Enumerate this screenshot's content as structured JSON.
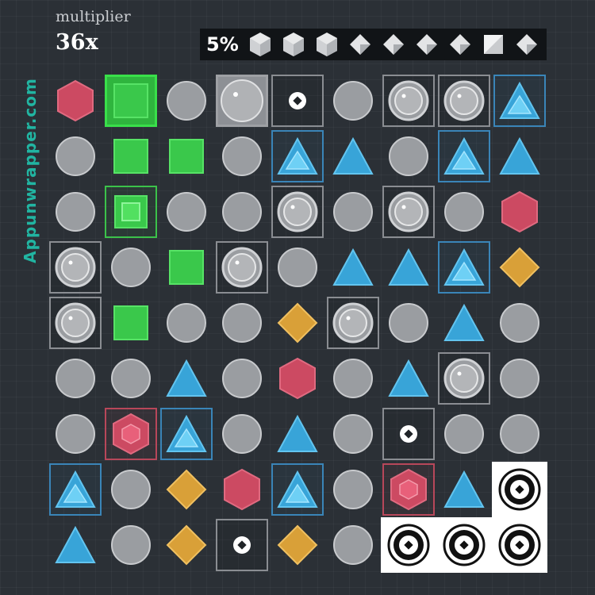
{
  "header": {
    "multiplier_label": "multiplier",
    "multiplier_value": "36x"
  },
  "progress": {
    "percent_text": "5%",
    "icons": [
      "cube-icon",
      "cube-icon",
      "cube-icon",
      "diamond-icon",
      "diamond-icon",
      "diamond-icon",
      "diamond-icon",
      "square-icon",
      "diamond-icon"
    ]
  },
  "watermark": "Appunwrapper.com",
  "colors": {
    "background": "#2b3036",
    "gray_piece": "#9a9da1",
    "green_piece": "#3ac84b",
    "blue_piece": "#38a4d8",
    "red_piece": "#cc4a62",
    "orange_piece": "#d9a038",
    "watermark": "#21b5a2"
  },
  "board": {
    "rows": 9,
    "cols": 9,
    "cells": [
      [
        {
          "p": "hexagon-red"
        },
        {
          "p": "square-green",
          "f": "greenfill"
        },
        {
          "p": "circle-gray"
        },
        {
          "p": "circle-bubble-big",
          "f": "grayfill"
        },
        {
          "p": "dot-target",
          "f": "gray"
        },
        {
          "p": "circle-gray"
        },
        {
          "p": "circle-bubble",
          "f": "gray"
        },
        {
          "p": "circle-bubble",
          "f": "gray"
        },
        {
          "p": "triangle-blue-inner",
          "f": "blue"
        }
      ],
      [
        {
          "p": "circle-gray"
        },
        {
          "p": "square-green"
        },
        {
          "p": "square-green"
        },
        {
          "p": "circle-gray"
        },
        {
          "p": "triangle-blue-inner",
          "f": "blue"
        },
        {
          "p": "triangle-blue"
        },
        {
          "p": "circle-gray"
        },
        {
          "p": "triangle-blue-inner",
          "f": "blue"
        },
        {
          "p": "triangle-blue"
        }
      ],
      [
        {
          "p": "circle-gray"
        },
        {
          "p": "square-green-inner",
          "f": "green"
        },
        {
          "p": "circle-gray"
        },
        {
          "p": "circle-gray"
        },
        {
          "p": "circle-bubble",
          "f": "gray"
        },
        {
          "p": "circle-gray"
        },
        {
          "p": "circle-bubble",
          "f": "gray"
        },
        {
          "p": "circle-gray"
        },
        {
          "p": "hexagon-red"
        }
      ],
      [
        {
          "p": "circle-bubble",
          "f": "gray"
        },
        {
          "p": "circle-gray"
        },
        {
          "p": "square-green"
        },
        {
          "p": "circle-bubble",
          "f": "gray"
        },
        {
          "p": "circle-gray"
        },
        {
          "p": "triangle-blue"
        },
        {
          "p": "triangle-blue"
        },
        {
          "p": "triangle-blue-inner",
          "f": "blue"
        },
        {
          "p": "diamond-orange"
        }
      ],
      [
        {
          "p": "circle-bubble",
          "f": "gray"
        },
        {
          "p": "square-green"
        },
        {
          "p": "circle-gray"
        },
        {
          "p": "circle-gray"
        },
        {
          "p": "diamond-orange"
        },
        {
          "p": "circle-bubble",
          "f": "gray"
        },
        {
          "p": "circle-gray"
        },
        {
          "p": "triangle-blue"
        },
        {
          "p": "circle-gray"
        }
      ],
      [
        {
          "p": "circle-gray"
        },
        {
          "p": "circle-gray"
        },
        {
          "p": "triangle-blue"
        },
        {
          "p": "circle-gray"
        },
        {
          "p": "hexagon-red"
        },
        {
          "p": "circle-gray"
        },
        {
          "p": "triangle-blue"
        },
        {
          "p": "circle-bubble",
          "f": "gray"
        },
        {
          "p": "circle-gray"
        }
      ],
      [
        {
          "p": "circle-gray"
        },
        {
          "p": "hexagon-red-inner",
          "f": "red"
        },
        {
          "p": "triangle-blue-inner",
          "f": "blue"
        },
        {
          "p": "circle-gray"
        },
        {
          "p": "triangle-blue"
        },
        {
          "p": "circle-gray"
        },
        {
          "p": "dot-target",
          "f": "gray"
        },
        {
          "p": "circle-gray"
        },
        {
          "p": "circle-gray"
        }
      ],
      [
        {
          "p": "triangle-blue-inner",
          "f": "blue"
        },
        {
          "p": "circle-gray"
        },
        {
          "p": "diamond-orange"
        },
        {
          "p": "hexagon-red"
        },
        {
          "p": "triangle-blue-inner",
          "f": "blue"
        },
        {
          "p": "circle-gray"
        },
        {
          "p": "hexagon-red-inner",
          "f": "red"
        },
        {
          "p": "triangle-blue"
        },
        {
          "p": "target-ring",
          "f": "target"
        }
      ],
      [
        {
          "p": "triangle-blue"
        },
        {
          "p": "circle-gray"
        },
        {
          "p": "diamond-orange"
        },
        {
          "p": "dot-target",
          "f": "gray"
        },
        {
          "p": "diamond-orange"
        },
        {
          "p": "circle-gray"
        },
        {
          "p": "target-ring",
          "f": "target"
        },
        {
          "p": "target-ring",
          "f": "target"
        },
        {
          "p": "target-ring",
          "f": "target"
        }
      ]
    ]
  }
}
